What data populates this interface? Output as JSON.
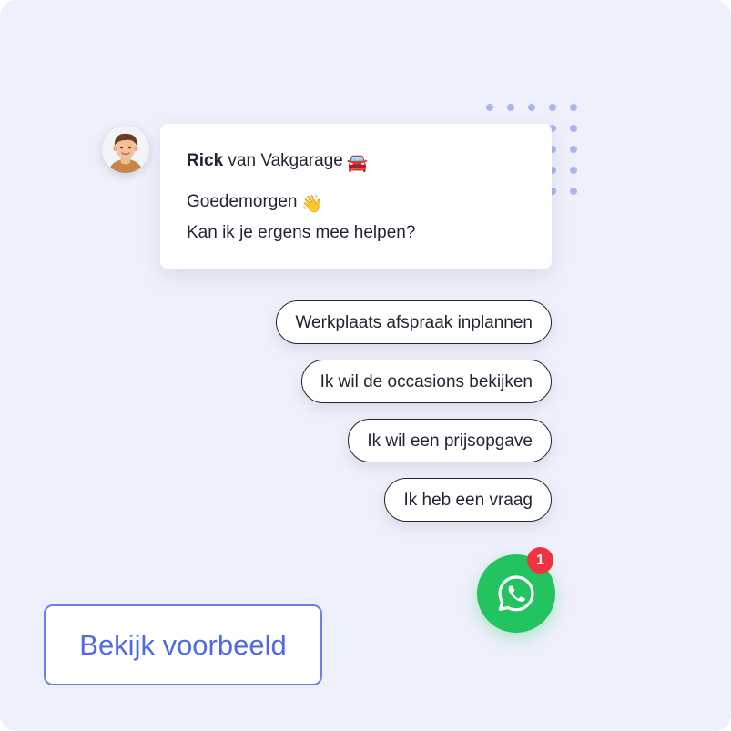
{
  "chat": {
    "agent_name": "Rick",
    "agent_company": "van Vakgarage",
    "agent_company_emoji": "🚘",
    "greeting": "Goedemorgen",
    "greeting_emoji": "👋",
    "question": "Kan ik je ergens mee helpen?"
  },
  "quick_replies": [
    "Werkplaats afspraak inplannen",
    "Ik wil de occasions bekijken",
    "Ik wil een prijsopgave",
    "Ik heb een vraag"
  ],
  "whatsapp": {
    "icon": "whatsapp-icon",
    "badge_count": "1",
    "color": "#21c45f"
  },
  "cta": {
    "label": "Bekijk voorbeeld",
    "color": "#5369e4"
  }
}
